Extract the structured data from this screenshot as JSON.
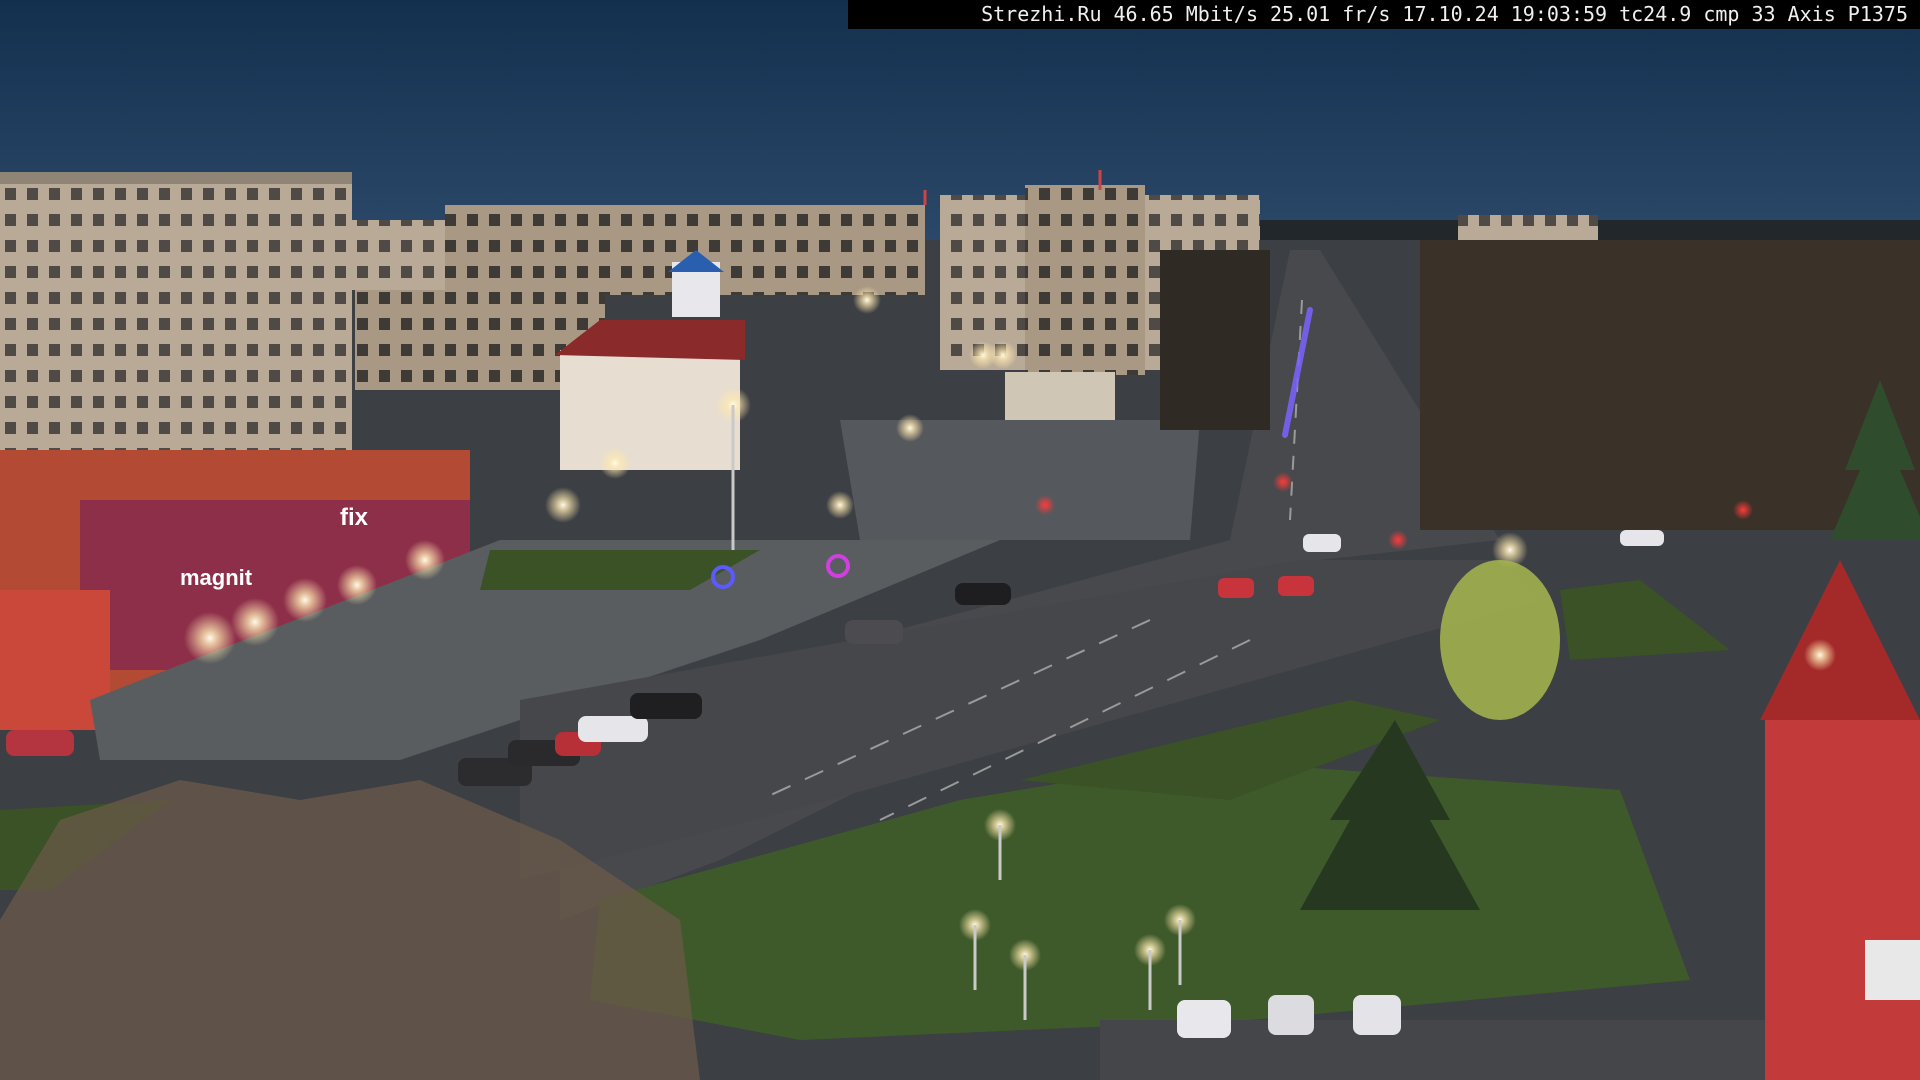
{
  "overlay": {
    "site": "Strezhi.Ru",
    "bitrate": "46.65 Mbit/s",
    "framerate": "25.01 fr/s",
    "date": "17.10.24",
    "time": "19:03:59",
    "tc": "tc24.9",
    "cmp": "cmp 33",
    "camera": "Axis P1375"
  },
  "scene": {
    "sky_color": "#1f3a5c",
    "lamp_color": "#fff6dc",
    "ground_color": "#4a4d52",
    "grass_color": "#3f5a2a"
  },
  "storefront": {
    "sign_left": "magnit",
    "sign_right": "fix"
  }
}
